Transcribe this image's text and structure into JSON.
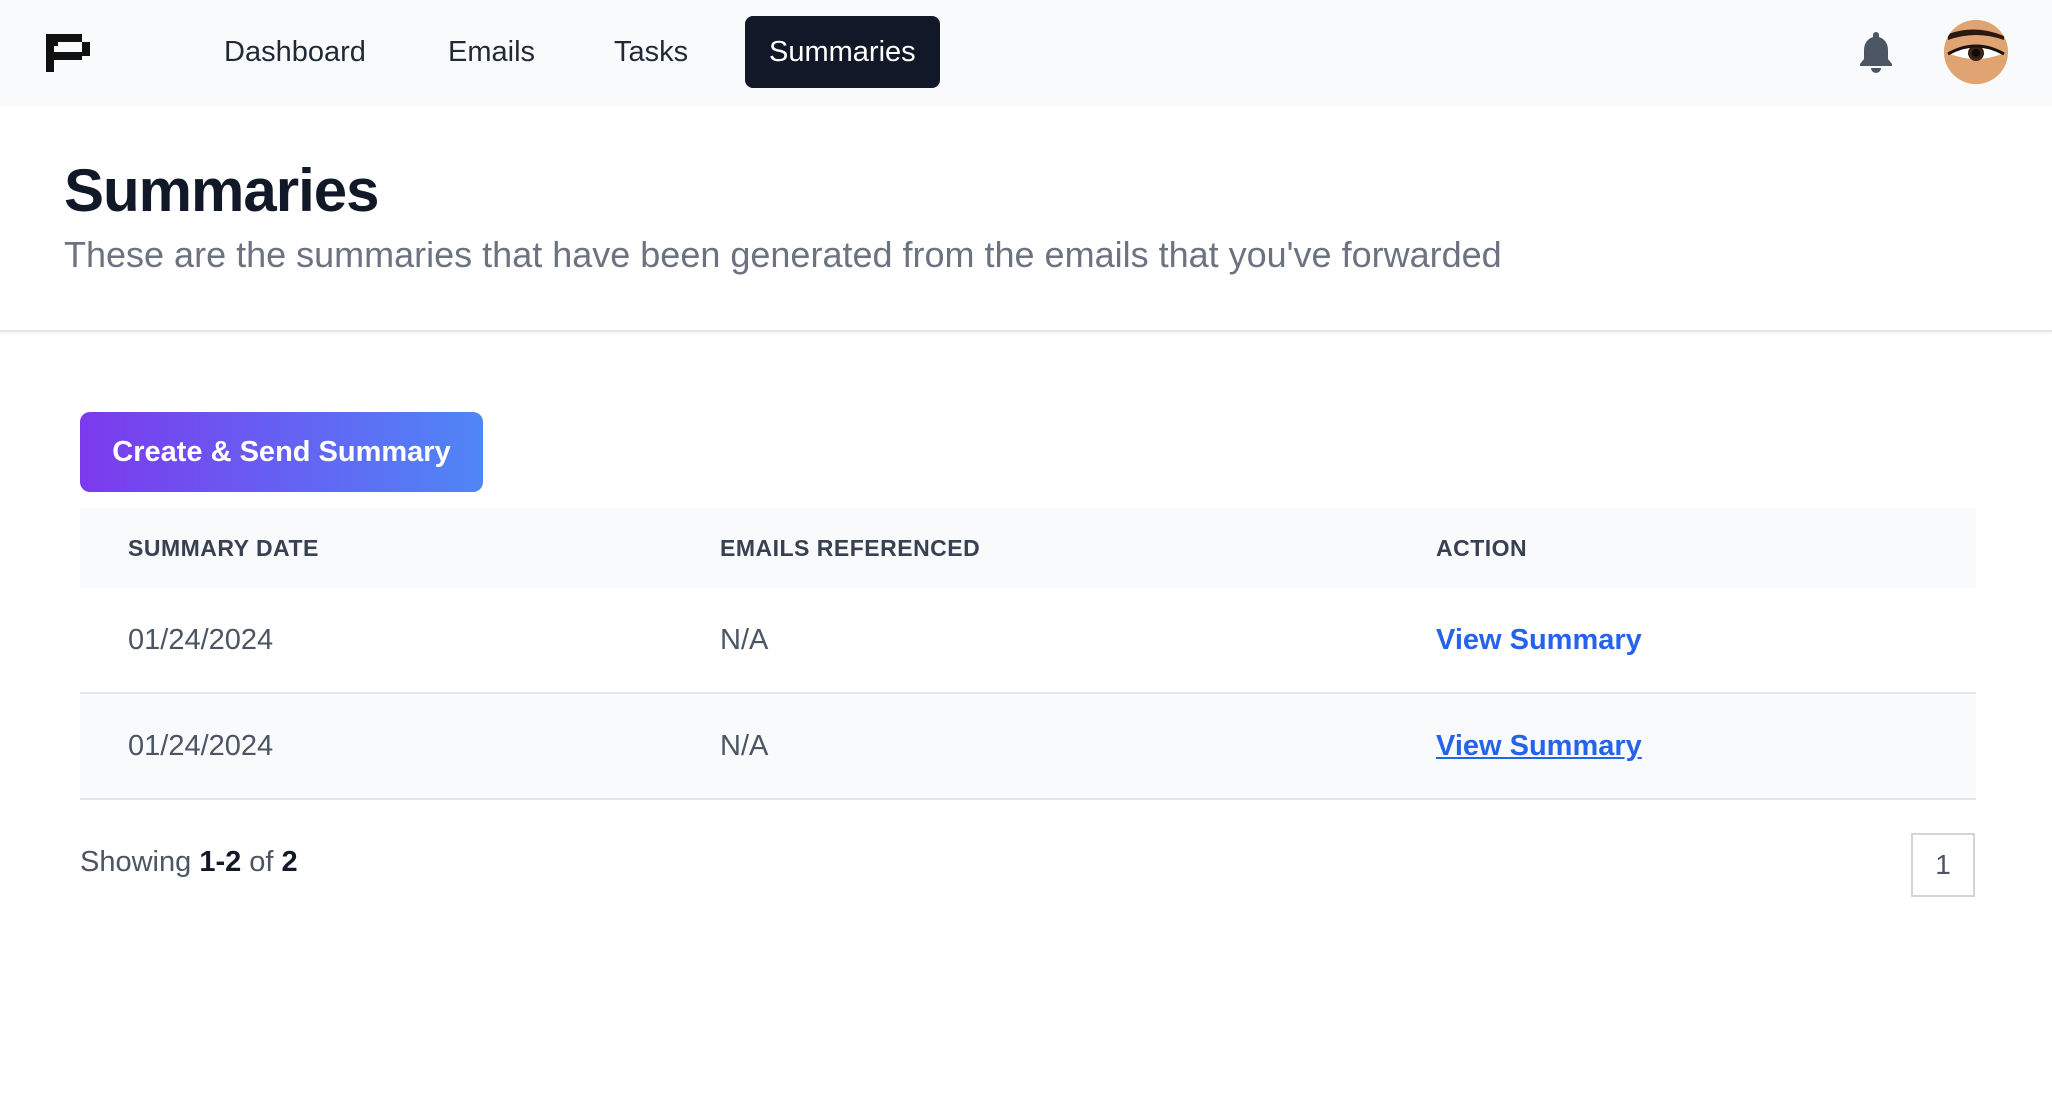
{
  "nav": {
    "logo_icon": "p-logo-icon",
    "items": [
      {
        "label": "Dashboard",
        "active": false
      },
      {
        "label": "Emails",
        "active": false
      },
      {
        "label": "Tasks",
        "active": false
      },
      {
        "label": "Summaries",
        "active": true
      }
    ],
    "bell_icon": "bell-icon",
    "avatar_icon": "avatar"
  },
  "header": {
    "title": "Summaries",
    "subtitle": "These are the summaries that have been generated from the emails that you've forwarded"
  },
  "actions": {
    "create_label": "Create & Send Summary"
  },
  "table": {
    "columns": [
      "SUMMARY DATE",
      "EMAILS REFERENCED",
      "ACTION"
    ],
    "rows": [
      {
        "date": "01/24/2024",
        "emails": "N/A",
        "action": "View Summary"
      },
      {
        "date": "01/24/2024",
        "emails": "N/A",
        "action": "View Summary"
      }
    ]
  },
  "pagination": {
    "prefix": "Showing",
    "range": "1-2",
    "of": "of",
    "total": "2",
    "current_page": "1"
  },
  "colors": {
    "nav_active_bg": "#111827",
    "button_gradient_start": "#7c3aed",
    "button_gradient_end": "#4f86f7",
    "link": "#2563eb"
  }
}
